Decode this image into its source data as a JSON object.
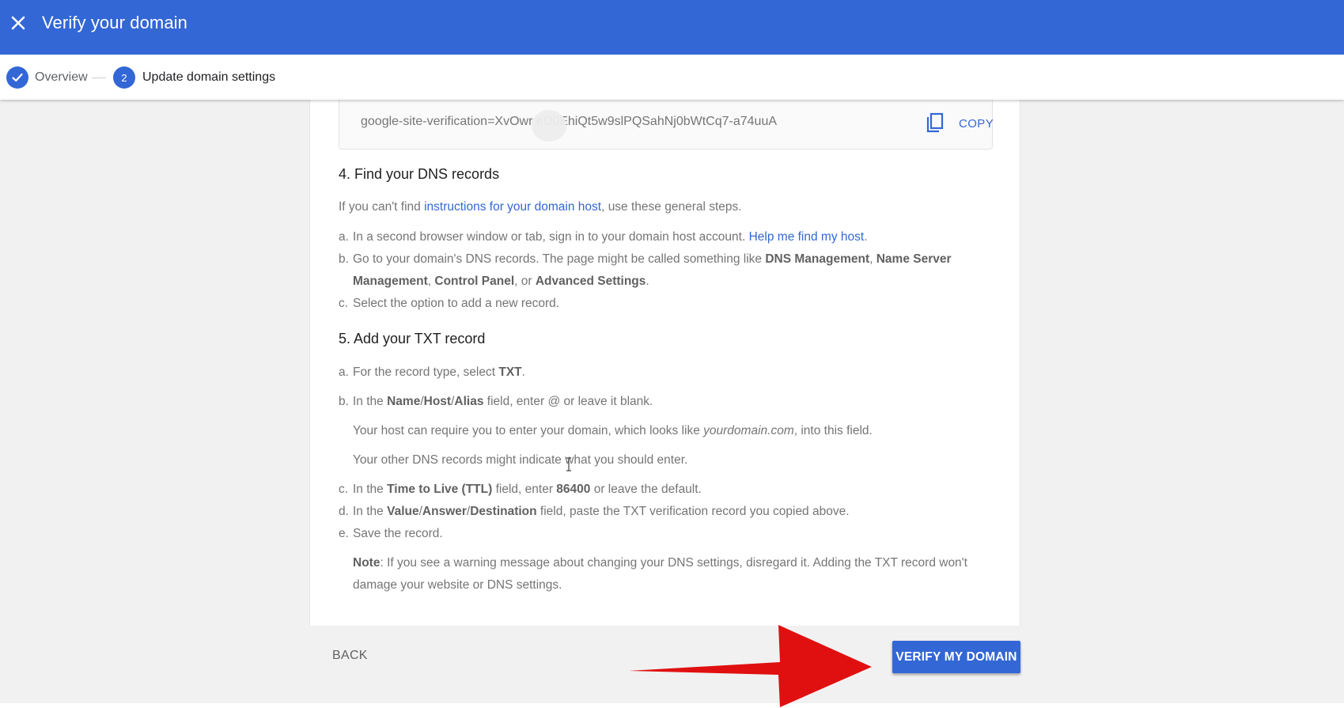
{
  "header": {
    "title": "Verify your domain"
  },
  "stepper": {
    "step1_label": "Overview",
    "step2_number": "2",
    "step2_label": "Update domain settings"
  },
  "verification": {
    "record": "google-site-verification=XvOwr      eD0EhiQt5w9slPQSahNj0bWtCq7-a74uuA",
    "copy_label": "COPY"
  },
  "section4": {
    "heading": "4. Find your DNS records",
    "intro_prefix": "If you can't find ",
    "intro_link": "instructions for your domain host",
    "intro_suffix": ", use these general steps.",
    "a_marker": "a.",
    "a_text": "In a second browser window or tab, sign in to your domain host account. ",
    "a_link": "Help me find my host",
    "a_end": ".",
    "b_marker": "b.",
    "b_text1": "Go to your domain's DNS records. The page might be called something like ",
    "b_bold1": "DNS Management",
    "b_sep1": ", ",
    "b_bold2": "Name Server",
    "b_bold3": "Management",
    "b_sep2": ", ",
    "b_bold4": "Control Panel",
    "b_sep3": ", or ",
    "b_bold5": "Advanced Settings",
    "b_end": ".",
    "c_marker": "c.",
    "c_text": "Select the option to add a new record."
  },
  "section5": {
    "heading": "5. Add your TXT record",
    "a_marker": "a.",
    "a_text": "For the record type, select ",
    "a_bold": "TXT",
    "a_end": ".",
    "b_marker": "b.",
    "b_text1": "In the ",
    "b_bold1": "Name",
    "b_slash1": "/",
    "b_bold2": "Host",
    "b_slash2": "/",
    "b_bold3": "Alias",
    "b_text2": " field, enter @ or leave it blank.",
    "b_sub1_prefix": "Your host can require you to enter your domain, which looks like ",
    "b_sub1_italic": "yourdomain.com",
    "b_sub1_suffix": ", into this field.",
    "b_sub2": "Your other DNS records might indicate what you should enter.",
    "c_marker": "c.",
    "c_text1": "In the ",
    "c_bold1": "Time to Live (TTL)",
    "c_text2": " field, enter ",
    "c_bold2": "86400",
    "c_text3": " or leave the default.",
    "d_marker": "d.",
    "d_text1": "In the ",
    "d_bold1": "Value",
    "d_slash1": "/",
    "d_bold2": "Answer",
    "d_slash2": "/",
    "d_bold3": "Destination",
    "d_text2": " field, paste the TXT verification record you copied above.",
    "e_marker": "e.",
    "e_text": "Save the record.",
    "note_bold": "Note",
    "note_text1": ": If you see a warning message about changing your DNS settings, disregard it. Adding the TXT record won't",
    "note_text2": "damage your website or DNS settings."
  },
  "footer": {
    "back_label": "BACK",
    "verify_label": "VERIFY MY DOMAIN"
  },
  "colors": {
    "primary": "#3367d6",
    "arrow": "#e01010"
  }
}
